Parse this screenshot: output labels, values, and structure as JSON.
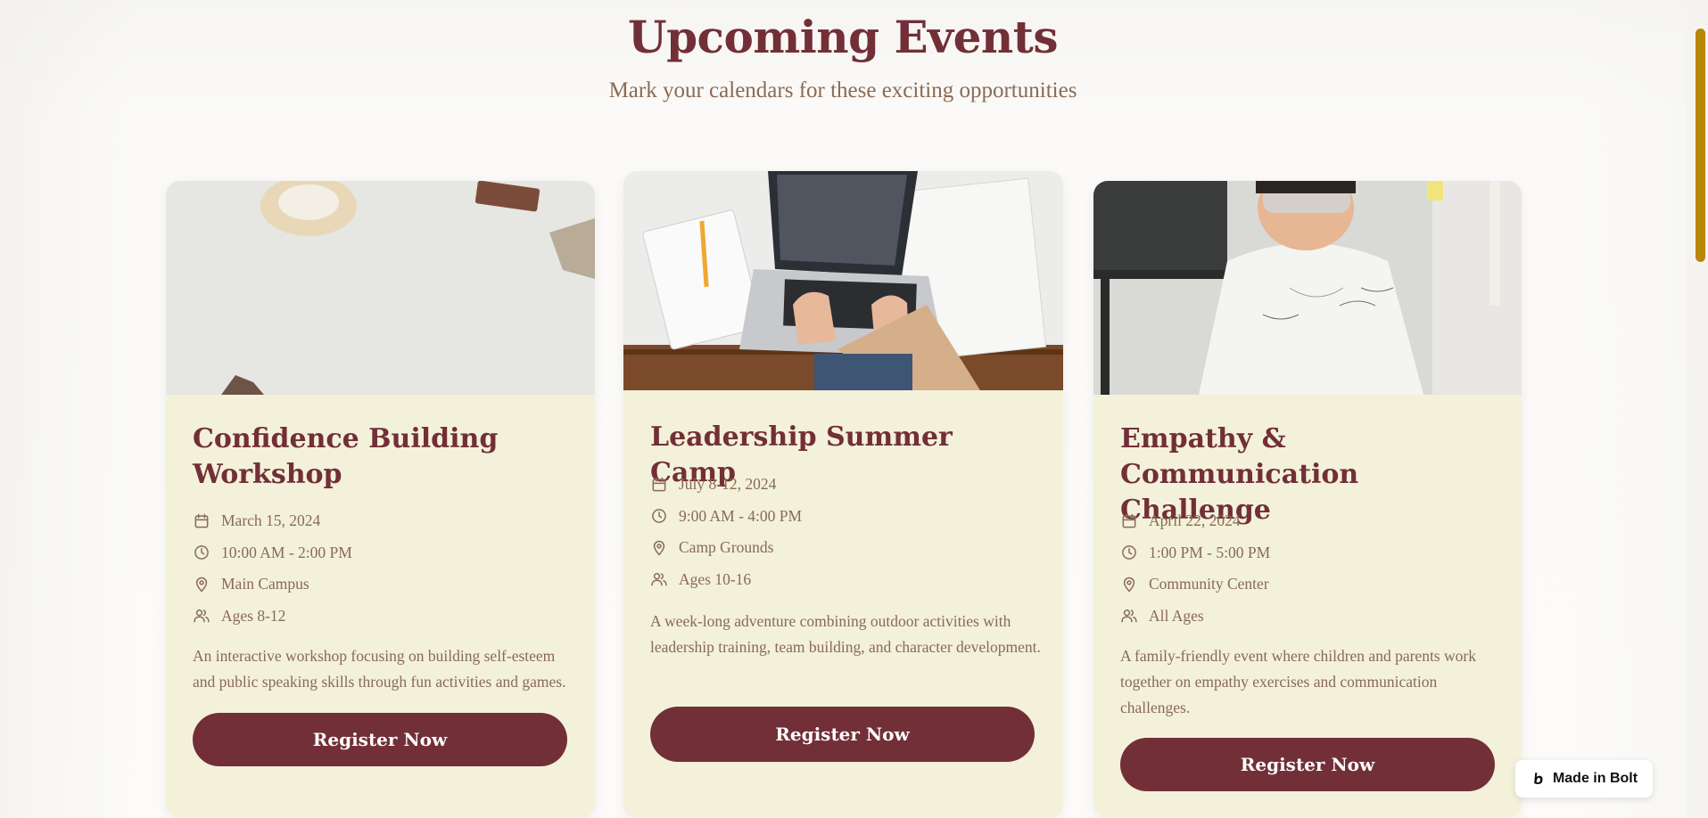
{
  "header": {
    "title": "Upcoming Events",
    "subtitle": "Mark your calendars for these exciting opportunities"
  },
  "events": [
    {
      "title": "Confidence Building Workshop",
      "date": "March 15, 2024",
      "time": "10:00 AM - 2:00 PM",
      "location": "Main Campus",
      "ages": "Ages 8-12",
      "description": "An interactive workshop focusing on building self-esteem and public speaking skills through fun activities and games.",
      "button_label": "Register Now"
    },
    {
      "title": "Leadership Summer Camp",
      "date": "July 8-12, 2024",
      "time": "9:00 AM - 4:00 PM",
      "location": "Camp Grounds",
      "ages": "Ages 10-16",
      "description": "A week-long adventure combining outdoor activities with leadership training, team building, and character development.",
      "button_label": "Register Now"
    },
    {
      "title": "Empathy & Communication Challenge",
      "date": "April 22, 2024",
      "time": "1:00 PM - 5:00 PM",
      "location": "Community Center",
      "ages": "All Ages",
      "description": "A family-friendly event where children and parents work together on empathy exercises and communication challenges.",
      "button_label": "Register Now"
    }
  ],
  "badge": {
    "label": "Made in Bolt",
    "icon": "bolt-logo-icon"
  },
  "colors": {
    "accent": "#722f37",
    "card_bg": "#f3f1da",
    "muted_text": "#8a6a55",
    "scrollbar": "#b8860b"
  }
}
